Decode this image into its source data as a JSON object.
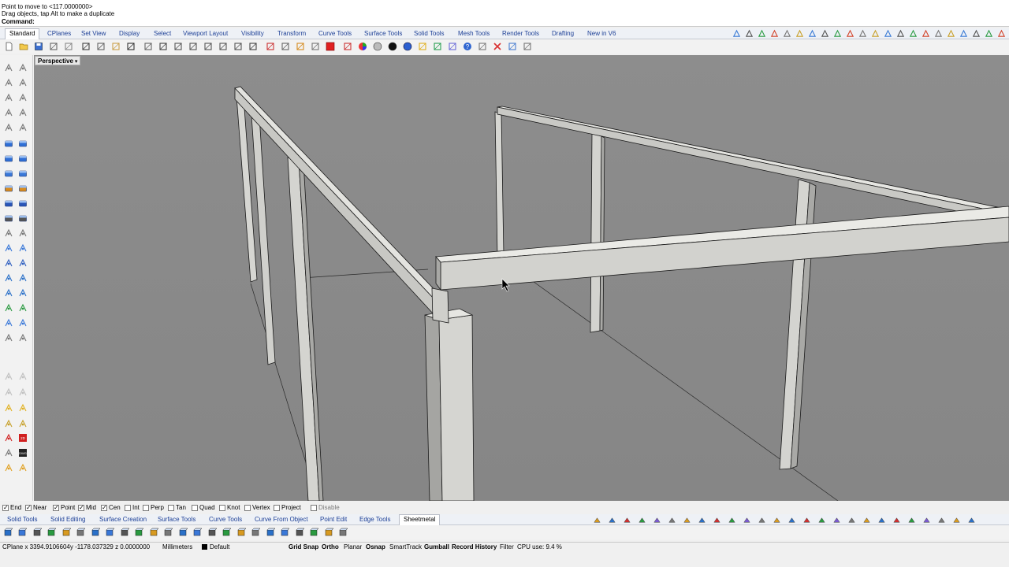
{
  "command": {
    "history": [
      "Point to move to <117.0000000>",
      "Drag objects, tap Alt to make a duplicate"
    ],
    "prompt": "Command:"
  },
  "main_tabs": [
    {
      "label": "Standard",
      "active": true
    },
    {
      "label": "CPlanes"
    },
    {
      "label": "Set View"
    },
    {
      "label": "Display"
    },
    {
      "label": "Select"
    },
    {
      "label": "Viewport Layout"
    },
    {
      "label": "Visibility"
    },
    {
      "label": "Transform"
    },
    {
      "label": "Curve Tools"
    },
    {
      "label": "Surface Tools"
    },
    {
      "label": "Solid Tools"
    },
    {
      "label": "Mesh Tools"
    },
    {
      "label": "Render Tools"
    },
    {
      "label": "Drafting"
    },
    {
      "label": "New in V6"
    }
  ],
  "viewport": {
    "label": "Perspective",
    "background_color": "#8a8a8a",
    "object_color": "#cfcfcb"
  },
  "osnaps": [
    {
      "label": "End",
      "checked": true
    },
    {
      "label": "Near",
      "checked": true
    },
    {
      "label": "Point",
      "checked": true
    },
    {
      "label": "Mid",
      "checked": true
    },
    {
      "label": "Cen",
      "checked": true
    },
    {
      "label": "Int",
      "checked": false
    },
    {
      "label": "Perp",
      "checked": false
    },
    {
      "label": "Tan",
      "checked": false
    },
    {
      "label": "Quad",
      "checked": false
    },
    {
      "label": "Knot",
      "checked": false
    },
    {
      "label": "Vertex",
      "checked": false
    },
    {
      "label": "Project",
      "checked": false
    },
    {
      "label": "Disable",
      "checked": false
    }
  ],
  "bottom_tabs": [
    {
      "label": "Solid Tools"
    },
    {
      "label": "Solid Editing"
    },
    {
      "label": "Surface Creation"
    },
    {
      "label": "Surface Tools"
    },
    {
      "label": "Curve Tools"
    },
    {
      "label": "Curve From Object"
    },
    {
      "label": "Point Edit"
    },
    {
      "label": "Edge Tools"
    },
    {
      "label": "Sheetmetal",
      "active": true
    }
  ],
  "status": {
    "coordinates": "CPlane x 3394.9106604y -1178.037329   z 0.0000000",
    "units": "Millimeters",
    "layer": "Default",
    "layer_color": "#000000",
    "grid_snap": "Grid Snap",
    "ortho": "Ortho",
    "planar": "Planar",
    "osnap": "Osnap",
    "smarttrack": "SmartTrack",
    "gumball": "Gumball",
    "record_history": "Record History",
    "filter": "Filter",
    "cpu": "CPU use: 9.4 %"
  },
  "icons": {
    "toolbar": [
      "new-file-icon",
      "open-icon",
      "save-icon",
      "print-icon",
      "import-icon",
      "cut-icon",
      "copy-icon",
      "paste-icon",
      "undo-icon",
      "pan-icon",
      "rotate-view-icon",
      "zoom-icon",
      "zoom-window-icon",
      "zoom-extents-icon",
      "zoom-selected-icon",
      "undo-view-icon",
      "grid-icon",
      "move-icon",
      "select-icon",
      "layer-icon",
      "properties-icon",
      "red-square-icon",
      "dim-icon",
      "color-wheel-icon",
      "shaded-icon",
      "render-icon",
      "material-icon",
      "sun-icon",
      "lights-icon",
      "options-icon",
      "help-icon",
      "fullscreen-icon",
      "close-tool-icon",
      "network-icon",
      "viewport-icon"
    ]
  }
}
